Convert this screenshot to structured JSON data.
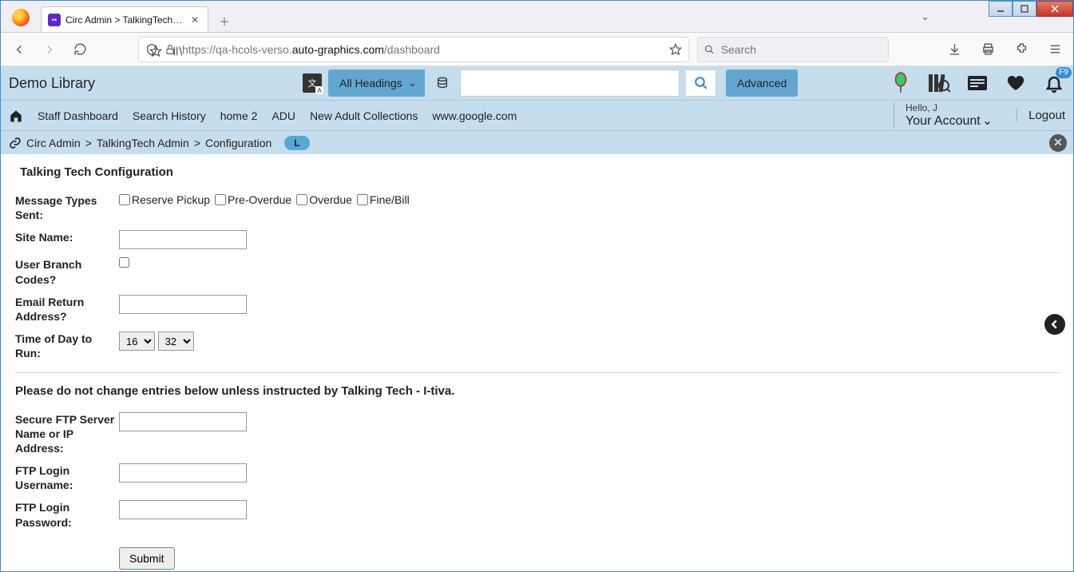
{
  "browser": {
    "tab_title": "Circ Admin > TalkingTech Adm",
    "url_prefix": "https://qa-hcols-verso.",
    "url_bold": "auto-graphics.com",
    "url_suffix": "/dashboard",
    "search_placeholder": "Search"
  },
  "header": {
    "library_name": "Demo Library",
    "headings_select": "All Headings",
    "advanced_label": "Advanced",
    "badge_text": "F9"
  },
  "nav": {
    "items": [
      "Staff Dashboard",
      "Search History",
      "home 2",
      "ADU",
      "New Adult Collections",
      "www.google.com"
    ],
    "hello": "Hello, J",
    "account": "Your Account",
    "logout": "Logout"
  },
  "breadcrumb": {
    "items": [
      "Circ Admin",
      "TalkingTech Admin",
      "Configuration"
    ],
    "pill": "L"
  },
  "page": {
    "title": "Talking Tech Configuration",
    "labels": {
      "msg_types": "Message Types Sent:",
      "site_name": "Site Name:",
      "user_branch": "User Branch Codes?",
      "email_return": "Email Return Address?",
      "time_of_day": "Time of Day to Run:",
      "warning": "Please do not change entries below unless instructed by Talking Tech - I-tiva.",
      "ftp_server": "Secure FTP Server Name or IP Address:",
      "ftp_user": "FTP Login Username:",
      "ftp_pass": "FTP Login Password:",
      "submit": "Submit"
    },
    "checkboxes": [
      "Reserve Pickup",
      "Pre-Overdue",
      "Overdue",
      "Fine/Bill"
    ],
    "hour": "16",
    "minute": "32"
  }
}
